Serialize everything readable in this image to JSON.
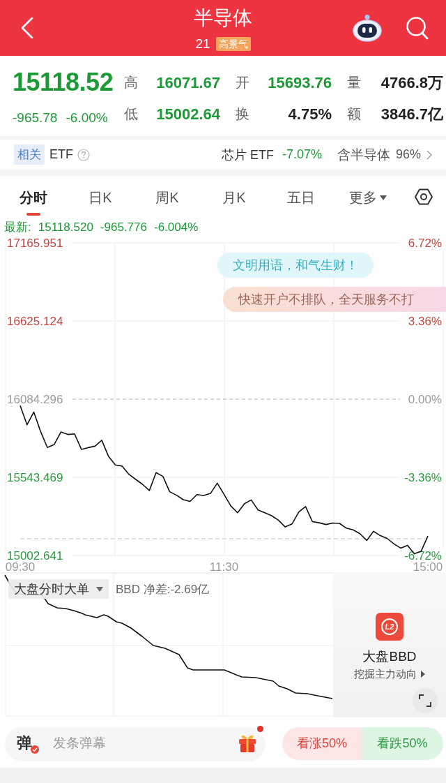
{
  "header": {
    "title": "半导体",
    "code": "21",
    "badge": "高景气"
  },
  "quote": {
    "price": "15118.52",
    "change": "-965.78",
    "change_pct": "-6.00%",
    "down": true,
    "stats": [
      {
        "label": "高",
        "value": "16071.67",
        "color": "#1c9a36"
      },
      {
        "label": "开",
        "value": "15693.76",
        "color": "#1c9a36"
      },
      {
        "label": "量",
        "value": "4766.8万",
        "color": "#222222"
      },
      {
        "label": "低",
        "value": "15002.64",
        "color": "#1c9a36"
      },
      {
        "label": "换",
        "value": "4.75%",
        "color": "#222222"
      },
      {
        "label": "额",
        "value": "3846.7亿",
        "color": "#222222"
      }
    ]
  },
  "related": {
    "tag": "相关",
    "label": "ETF",
    "etf_name": "芯片 ETF",
    "etf_change": "-7.07%",
    "etf_down": true,
    "holding_label": "含半导体",
    "holding_pct": "96%"
  },
  "tabs": [
    {
      "label": "分时",
      "selected": true,
      "kind": "tab"
    },
    {
      "label": "日K",
      "selected": false,
      "kind": "tab"
    },
    {
      "label": "周K",
      "selected": false,
      "kind": "tab"
    },
    {
      "label": "月K",
      "selected": false,
      "kind": "tab"
    },
    {
      "label": "五日",
      "selected": false,
      "kind": "tab"
    },
    {
      "label": "更多",
      "selected": false,
      "kind": "menu"
    }
  ],
  "chart": {
    "latest": {
      "label": "最新:",
      "price": "15118.520",
      "change": "-965.776",
      "change_pct": "-6.004%",
      "down": true
    },
    "right_axis_labels": [
      "6.72%",
      "3.36%",
      "0.00%",
      "-3.36%",
      "-6.72%"
    ],
    "bubbles": [
      {
        "text": "文明用语，和气生财！",
        "kind": "plain"
      },
      {
        "text": "快速开户不排队，全天服务不打",
        "kind": "promo"
      }
    ],
    "chart_data": {
      "type": "line",
      "ylim": [
        15002.641,
        17165.951
      ],
      "yticks": [
        {
          "value": 17165.951,
          "label": "17165.951"
        },
        {
          "value": 16625.124,
          "label": "16625.124"
        },
        {
          "value": 16084.296,
          "label": "16084.296"
        },
        {
          "value": 15543.469,
          "label": "15543.469"
        },
        {
          "value": 15002.641,
          "label": "15002.641"
        }
      ],
      "categories": [
        "09:30",
        null,
        null,
        null,
        null,
        null,
        null,
        null,
        null,
        null,
        null,
        null,
        null,
        null,
        null,
        null,
        null,
        null,
        null,
        null,
        null,
        null,
        null,
        null,
        null,
        null,
        null,
        null,
        null,
        null,
        "11:30",
        null,
        null,
        null,
        null,
        null,
        null,
        null,
        null,
        null,
        null,
        null,
        null,
        null,
        null,
        null,
        null,
        null,
        null,
        null,
        null,
        null,
        null,
        null,
        null,
        null,
        null,
        null,
        null,
        null,
        "15:00"
      ],
      "series": [
        {
          "color": "#111111",
          "values": [
            16040,
            15907,
            15995,
            15860,
            15750,
            15771,
            15858,
            15840,
            15844,
            15737,
            15749,
            15759,
            15800,
            15688,
            15629,
            15621,
            15564,
            15529,
            15495,
            15452,
            15576,
            15550,
            15444,
            15420,
            15389,
            15377,
            15424,
            15418,
            15432,
            15503,
            15426,
            15345,
            15298,
            15361,
            15387,
            15318,
            15298,
            15278,
            15247,
            15200,
            15221,
            15304,
            15341,
            15237,
            15229,
            15217,
            15227,
            15225,
            15192,
            15180,
            15154,
            15107,
            15170,
            15140,
            15121,
            15083,
            15054,
            15073,
            15014,
            15032,
            15137
          ]
        },
        {
          "color": "#cdcdcd",
          "line_style": "dashed",
          "values": [
            15119,
            15119,
            15119,
            15119,
            15119,
            15119,
            15119,
            15119,
            15119,
            15119,
            15119,
            15119,
            15119,
            15119,
            15119,
            15119,
            15119,
            15119,
            15119,
            15119,
            15119,
            15119,
            15119,
            15119,
            15119,
            15119,
            15119,
            15119,
            15119,
            15119,
            15119,
            15119,
            15119,
            15119,
            15119,
            15119,
            15119,
            15119,
            15119,
            15119,
            15119,
            15119,
            15119,
            15119,
            15119,
            15119,
            15119,
            15119,
            15119,
            15119,
            15119,
            15119,
            15119,
            15119,
            15119,
            15119,
            15119,
            15119,
            15119,
            15119,
            15119
          ]
        }
      ]
    }
  },
  "bbd": {
    "selector": "大盘分时大单",
    "metric": "BBD 净差:-2.69亿",
    "promo": {
      "logo": "L2",
      "title": "大盘BBD",
      "subtitle": "挖掘主力动向"
    }
  },
  "bottom_bar": {
    "toggle": {
      "label": "弹",
      "on": true
    },
    "input": {
      "placeholder": "发条弹幕"
    },
    "gift": {
      "notice": true
    },
    "votes": [
      {
        "label": "看涨50%",
        "kind": "rise"
      },
      {
        "label": "看跌50%",
        "kind": "fall"
      }
    ]
  }
}
